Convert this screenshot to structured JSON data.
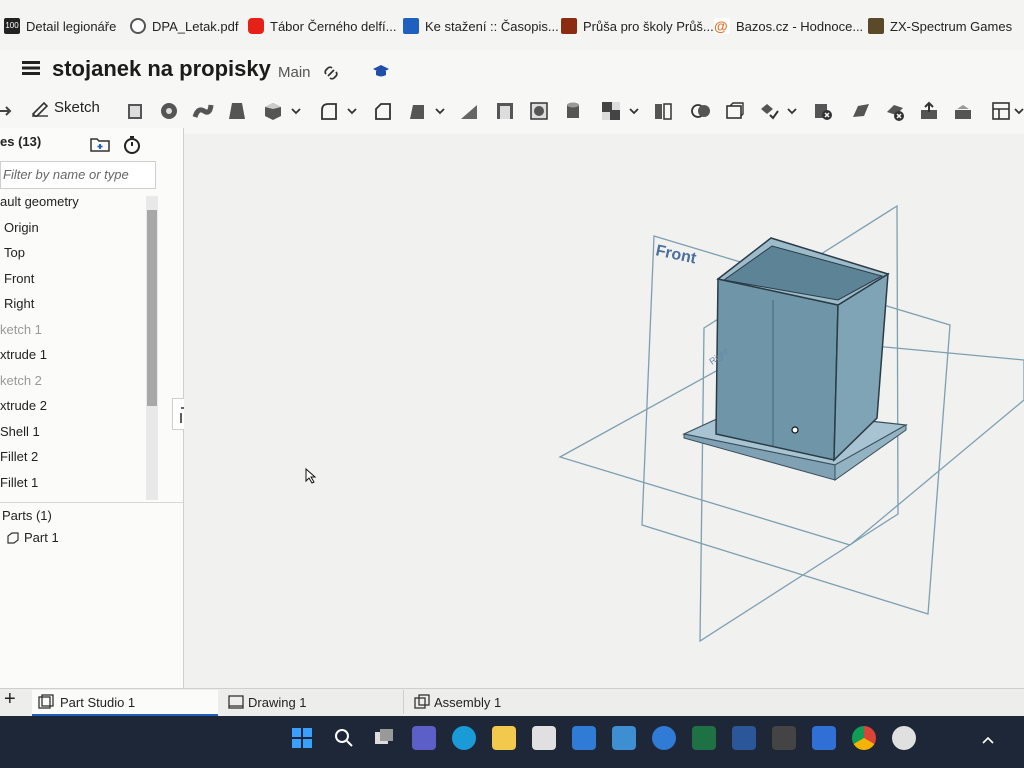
{
  "bookmarks": [
    {
      "label": "Detail legionáře",
      "icon": "site-100-icon",
      "color": "#222222"
    },
    {
      "label": "DPA_Letak.pdf",
      "icon": "globe-icon",
      "color": "#555555"
    },
    {
      "label": "Tábor Černého delfí...",
      "icon": "youtube-icon",
      "color": "#e62117"
    },
    {
      "label": "Ke stažení :: Časopis...",
      "icon": "site-wn-icon",
      "color": "#1f5fbf"
    },
    {
      "label": "Průša pro školy Průš...",
      "icon": "prusa-icon",
      "color": "#8b2b10"
    },
    {
      "label": "Bazos.cz - Hodnoce...",
      "icon": "bazos-icon",
      "color": "#e8732a"
    },
    {
      "label": "ZX-Spectrum Games",
      "icon": "zx-icon",
      "color": "#5a4a2a"
    }
  ],
  "header": {
    "doc_title": "stojanek na propisky",
    "branch": "Main"
  },
  "toolbar": {
    "sketch_label": "Sketch"
  },
  "sidebar": {
    "features_header": "es (13)",
    "filter_placeholder": "Filter by name or type",
    "features": [
      {
        "label": "ault geometry",
        "dim": false
      },
      {
        "label": "Origin",
        "dim": false
      },
      {
        "label": "Top",
        "dim": false
      },
      {
        "label": "Front",
        "dim": false
      },
      {
        "label": "Right",
        "dim": false
      },
      {
        "label": "ketch 1",
        "dim": true
      },
      {
        "label": "xtrude 1",
        "dim": false
      },
      {
        "label": "ketch 2",
        "dim": true
      },
      {
        "label": "xtrude 2",
        "dim": false
      },
      {
        "label": "Shell 1",
        "dim": false
      },
      {
        "label": "Fillet 2",
        "dim": false
      },
      {
        "label": "Fillet 1",
        "dim": false
      }
    ],
    "parts_header": "Parts (1)",
    "parts": [
      "Part 1"
    ]
  },
  "viewport": {
    "plane_front": "Front",
    "plane_right": "Right",
    "model_color": "#6f95a8"
  },
  "tabs": {
    "add": "+",
    "items": [
      "Part Studio 1",
      "Drawing 1",
      "Assembly 1"
    ]
  },
  "taskbar": {
    "icons": [
      "windows-start-icon",
      "search-icon",
      "task-view-icon",
      "teams-icon",
      "edge-icon",
      "file-explorer-icon",
      "store-icon",
      "mail-icon",
      "desktop-icon",
      "help-icon",
      "excel-icon",
      "word-icon",
      "solitaire-icon",
      "app-c-icon",
      "chrome-icon",
      "app-swirl-icon"
    ]
  }
}
